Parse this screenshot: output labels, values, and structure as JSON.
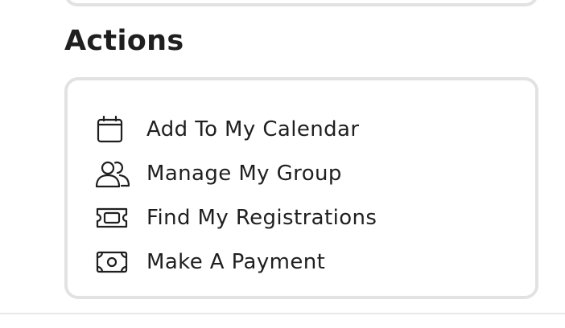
{
  "section": {
    "title": "Actions"
  },
  "actions": {
    "items": [
      {
        "label": "Add To My Calendar",
        "icon": "calendar-icon"
      },
      {
        "label": "Manage My Group",
        "icon": "group-icon"
      },
      {
        "label": "Find My Registrations",
        "icon": "ticket-icon"
      },
      {
        "label": "Make A Payment",
        "icon": "money-icon"
      }
    ]
  },
  "colors": {
    "text": "#1f1f1f",
    "card_border": "#e2e2e2",
    "background": "#ffffff"
  }
}
